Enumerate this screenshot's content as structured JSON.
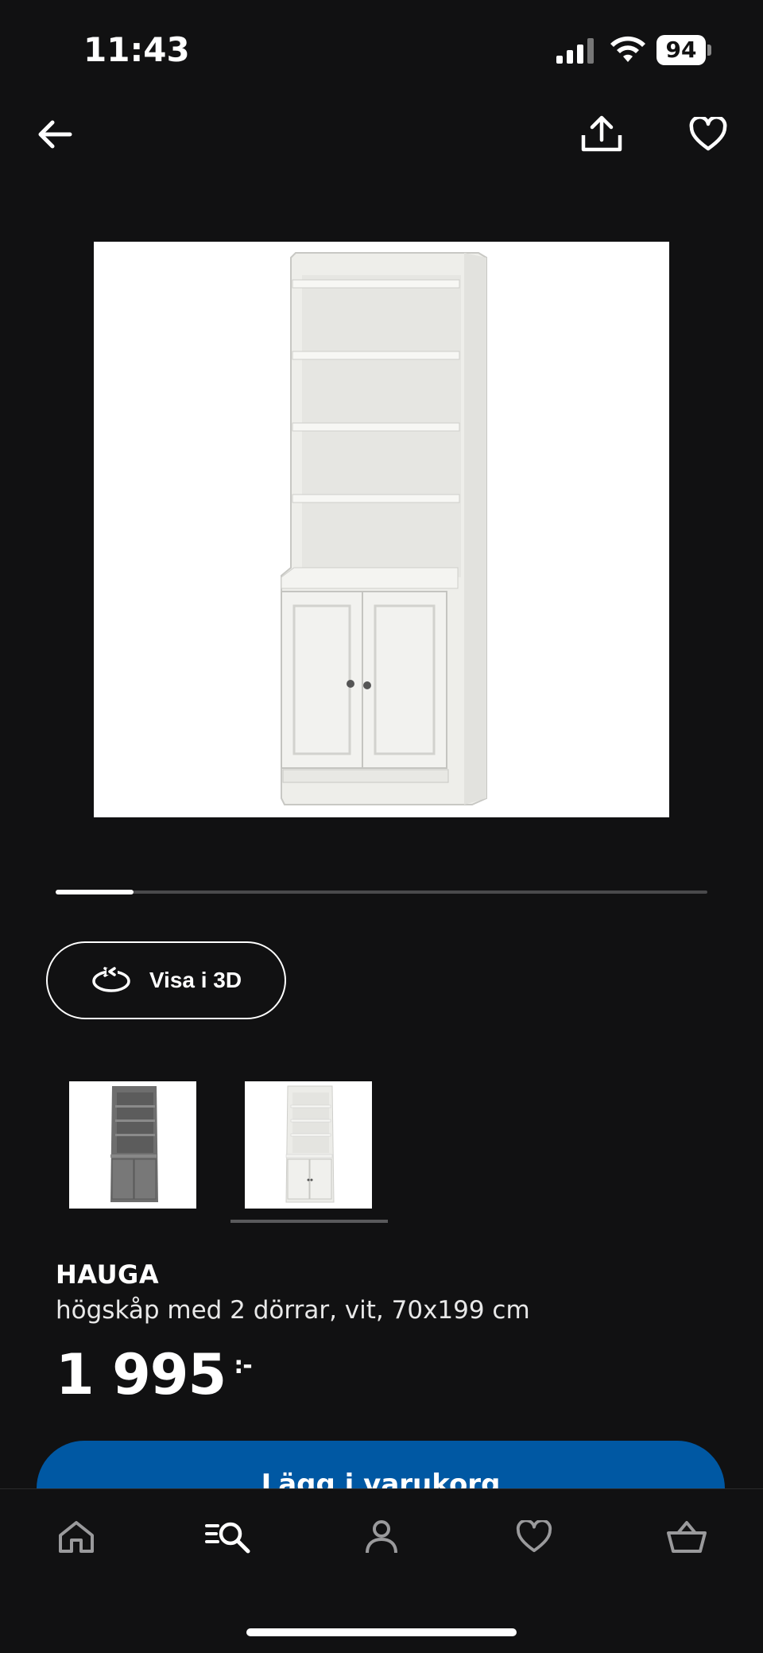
{
  "status_bar": {
    "time": "11:43",
    "battery": "94"
  },
  "product": {
    "brand": "HAUGA",
    "description": "högskåp med 2 dörrar, vit, 70x199 cm",
    "price": "1 995",
    "currency": ":-"
  },
  "gallery": {
    "progress": 0.12,
    "view_3d_label": "Visa i 3D",
    "thumbnails": [
      "grey-cabinet",
      "white-cabinet"
    ],
    "selected_thumbnail": 1
  },
  "actions": {
    "add_to_cart_label": "Lägg i varukorg"
  },
  "colors": {
    "accent": "#0058a3",
    "background": "#111112"
  },
  "nav": [
    "home-icon",
    "search-icon",
    "profile-icon",
    "heart-icon",
    "basket-icon"
  ]
}
